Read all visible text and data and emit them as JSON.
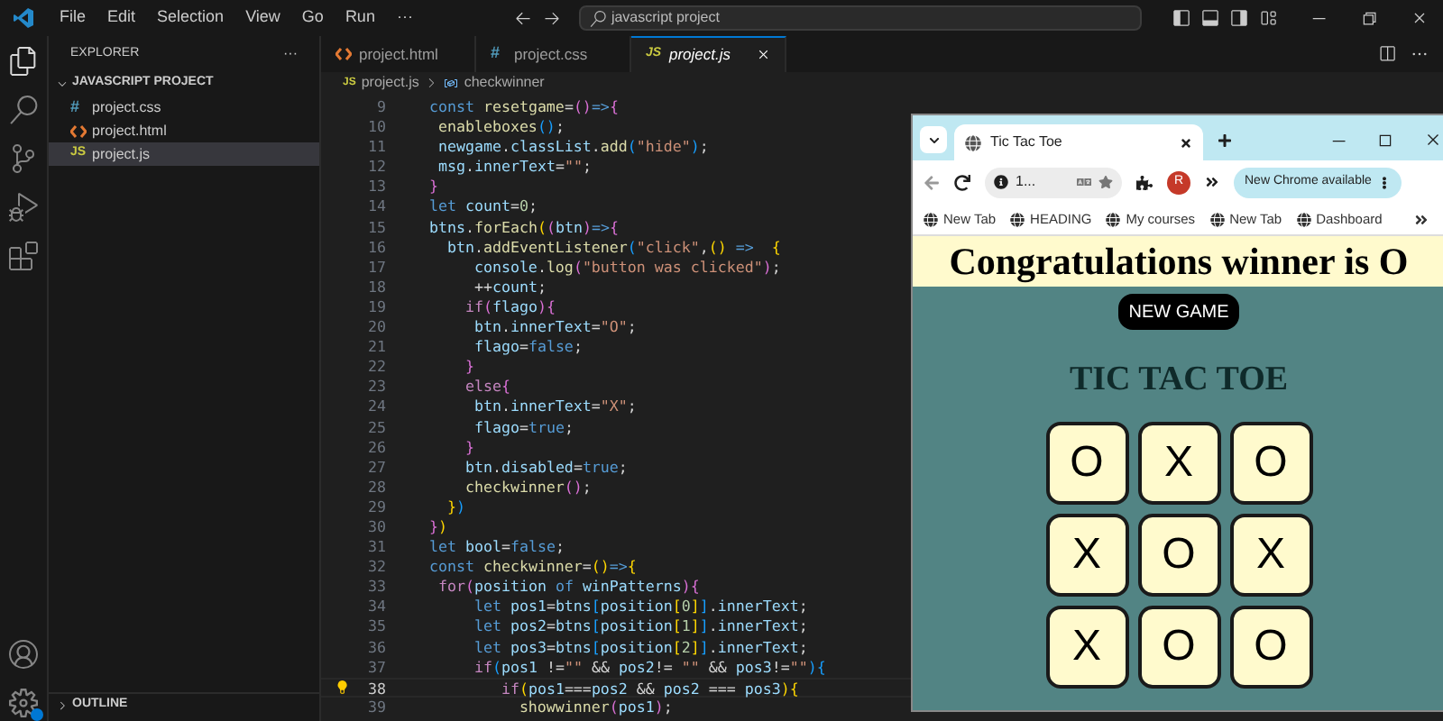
{
  "titlebar": {
    "menu": [
      "File",
      "Edit",
      "Selection",
      "View",
      "Go",
      "Run",
      "···"
    ],
    "search": "javascript project"
  },
  "explorer": {
    "title": "EXPLORER",
    "more": "···",
    "project": {
      "name": "JAVASCRIPT PROJECT",
      "expanded": true,
      "files": [
        {
          "name": "project.css",
          "kind": "css",
          "badge": "#",
          "selected": false
        },
        {
          "name": "project.html",
          "kind": "html",
          "selected": false
        },
        {
          "name": "project.js",
          "kind": "js",
          "badge": "JS",
          "selected": true
        }
      ]
    },
    "outline": {
      "name": "OUTLINE",
      "expanded": false
    }
  },
  "editor": {
    "tabs": [
      {
        "name": "project.html",
        "kind": "html",
        "selected": false
      },
      {
        "name": "project.css",
        "kind": "css",
        "badge": "#",
        "selected": false
      },
      {
        "name": "project.js",
        "kind": "js",
        "badge": "JS",
        "selected": true
      }
    ],
    "breadcrumb": {
      "file": "project.js",
      "badge": "JS",
      "symbol": "checkwinner"
    },
    "lines": [
      {
        "number": "9",
        "current": false,
        "tokens": [
          {
            "kind": "kw",
            "text": "  const "
          },
          {
            "kind": "fn",
            "text": "resetgame"
          },
          {
            "kind": "op",
            "text": "="
          },
          {
            "kind": "b2",
            "text": "()"
          },
          {
            "kind": "kw",
            "text": "=>"
          },
          {
            "kind": "b2",
            "text": "{"
          }
        ]
      },
      {
        "number": "10",
        "current": false,
        "tokens": [
          {
            "kind": "fn",
            "text": "   enableboxes"
          },
          {
            "kind": "b3",
            "text": "()"
          },
          {
            "kind": "op",
            "text": ";"
          }
        ]
      },
      {
        "number": "11",
        "current": false,
        "tokens": [
          {
            "kind": "var",
            "text": "   newgame"
          },
          {
            "kind": "op",
            "text": "."
          },
          {
            "kind": "var",
            "text": "classList"
          },
          {
            "kind": "op",
            "text": "."
          },
          {
            "kind": "fn",
            "text": "add"
          },
          {
            "kind": "b3",
            "text": "("
          },
          {
            "kind": "str",
            "text": "\"hide\""
          },
          {
            "kind": "b3",
            "text": ")"
          },
          {
            "kind": "op",
            "text": ";"
          }
        ]
      },
      {
        "number": "12",
        "current": false,
        "tokens": [
          {
            "kind": "var",
            "text": "   msg"
          },
          {
            "kind": "op",
            "text": "."
          },
          {
            "kind": "var",
            "text": "innerText"
          },
          {
            "kind": "op",
            "text": "="
          },
          {
            "kind": "str",
            "text": "\"\""
          },
          {
            "kind": "op",
            "text": ";"
          }
        ]
      },
      {
        "number": "13",
        "current": false,
        "tokens": [
          {
            "kind": "b2",
            "text": "  }"
          }
        ]
      },
      {
        "number": "14",
        "current": false,
        "tokens": [
          {
            "kind": "kw",
            "text": "  let "
          },
          {
            "kind": "var",
            "text": "count"
          },
          {
            "kind": "op",
            "text": "="
          },
          {
            "kind": "num",
            "text": "0"
          },
          {
            "kind": "op",
            "text": ";"
          }
        ]
      },
      {
        "number": "15",
        "current": false,
        "tokens": [
          {
            "kind": "var",
            "text": "  btns"
          },
          {
            "kind": "op",
            "text": "."
          },
          {
            "kind": "fn",
            "text": "forEach"
          },
          {
            "kind": "b1",
            "text": "("
          },
          {
            "kind": "b2",
            "text": "("
          },
          {
            "kind": "var",
            "text": "btn"
          },
          {
            "kind": "b2",
            "text": ")"
          },
          {
            "kind": "kw",
            "text": "=>"
          },
          {
            "kind": "b2",
            "text": "{"
          }
        ]
      },
      {
        "number": "16",
        "current": false,
        "tokens": [
          {
            "kind": "var",
            "text": "    btn"
          },
          {
            "kind": "op",
            "text": "."
          },
          {
            "kind": "fn",
            "text": "addEventListener"
          },
          {
            "kind": "b3",
            "text": "("
          },
          {
            "kind": "str",
            "text": "\"click\""
          },
          {
            "kind": "op",
            "text": ","
          },
          {
            "kind": "b1",
            "text": "()"
          },
          {
            "kind": "kw",
            "text": " =>  "
          },
          {
            "kind": "b1",
            "text": "{"
          }
        ]
      },
      {
        "number": "17",
        "current": false,
        "tokens": [
          {
            "kind": "var",
            "text": "       console"
          },
          {
            "kind": "op",
            "text": "."
          },
          {
            "kind": "fn",
            "text": "log"
          },
          {
            "kind": "b2",
            "text": "("
          },
          {
            "kind": "str",
            "text": "\"button was clicked\""
          },
          {
            "kind": "b2",
            "text": ")"
          },
          {
            "kind": "op",
            "text": ";"
          }
        ]
      },
      {
        "number": "18",
        "current": false,
        "tokens": [
          {
            "kind": "op",
            "text": "       ++"
          },
          {
            "kind": "var",
            "text": "count"
          },
          {
            "kind": "op",
            "text": ";"
          }
        ]
      },
      {
        "number": "19",
        "current": false,
        "tokens": [
          {
            "kind": "ctl",
            "text": "      if"
          },
          {
            "kind": "b2",
            "text": "("
          },
          {
            "kind": "var",
            "text": "flago"
          },
          {
            "kind": "b2",
            "text": "){"
          }
        ]
      },
      {
        "number": "20",
        "current": false,
        "tokens": [
          {
            "kind": "var",
            "text": "       btn"
          },
          {
            "kind": "op",
            "text": "."
          },
          {
            "kind": "var",
            "text": "innerText"
          },
          {
            "kind": "op",
            "text": "="
          },
          {
            "kind": "str",
            "text": "\"O\""
          },
          {
            "kind": "op",
            "text": ";"
          }
        ]
      },
      {
        "number": "21",
        "current": false,
        "tokens": [
          {
            "kind": "var",
            "text": "       flago"
          },
          {
            "kind": "op",
            "text": "="
          },
          {
            "kind": "kw",
            "text": "false"
          },
          {
            "kind": "op",
            "text": ";"
          }
        ]
      },
      {
        "number": "22",
        "current": false,
        "tokens": [
          {
            "kind": "b2",
            "text": "      }"
          }
        ]
      },
      {
        "number": "23",
        "current": false,
        "tokens": [
          {
            "kind": "ctl",
            "text": "      else"
          },
          {
            "kind": "b2",
            "text": "{"
          }
        ]
      },
      {
        "number": "24",
        "current": false,
        "tokens": [
          {
            "kind": "var",
            "text": "       btn"
          },
          {
            "kind": "op",
            "text": "."
          },
          {
            "kind": "var",
            "text": "innerText"
          },
          {
            "kind": "op",
            "text": "="
          },
          {
            "kind": "str",
            "text": "\"X\""
          },
          {
            "kind": "op",
            "text": ";"
          }
        ]
      },
      {
        "number": "25",
        "current": false,
        "tokens": [
          {
            "kind": "var",
            "text": "       flago"
          },
          {
            "kind": "op",
            "text": "="
          },
          {
            "kind": "kw",
            "text": "true"
          },
          {
            "kind": "op",
            "text": ";"
          }
        ]
      },
      {
        "number": "26",
        "current": false,
        "tokens": [
          {
            "kind": "b2",
            "text": "      }"
          }
        ]
      },
      {
        "number": "27",
        "current": false,
        "tokens": [
          {
            "kind": "var",
            "text": "      btn"
          },
          {
            "kind": "op",
            "text": "."
          },
          {
            "kind": "var",
            "text": "disabled"
          },
          {
            "kind": "op",
            "text": "="
          },
          {
            "kind": "kw",
            "text": "true"
          },
          {
            "kind": "op",
            "text": ";"
          }
        ]
      },
      {
        "number": "28",
        "current": false,
        "tokens": [
          {
            "kind": "fn",
            "text": "      checkwinner"
          },
          {
            "kind": "b2",
            "text": "()"
          },
          {
            "kind": "op",
            "text": ";"
          }
        ]
      },
      {
        "number": "29",
        "current": false,
        "tokens": [
          {
            "kind": "b1",
            "text": "    }"
          },
          {
            "kind": "b3",
            "text": ")"
          }
        ]
      },
      {
        "number": "30",
        "current": false,
        "tokens": [
          {
            "kind": "b2",
            "text": "  }"
          },
          {
            "kind": "b1",
            "text": ")"
          }
        ]
      },
      {
        "number": "31",
        "current": false,
        "tokens": [
          {
            "kind": "kw",
            "text": "  let "
          },
          {
            "kind": "var",
            "text": "bool"
          },
          {
            "kind": "op",
            "text": "="
          },
          {
            "kind": "kw",
            "text": "false"
          },
          {
            "kind": "op",
            "text": ";"
          }
        ]
      },
      {
        "number": "32",
        "current": false,
        "tokens": [
          {
            "kind": "kw",
            "text": "  const "
          },
          {
            "kind": "fn",
            "text": "checkwinner"
          },
          {
            "kind": "op",
            "text": "="
          },
          {
            "kind": "b1",
            "text": "()"
          },
          {
            "kind": "kw",
            "text": "=>"
          },
          {
            "kind": "b1",
            "text": "{"
          }
        ]
      },
      {
        "number": "33",
        "current": false,
        "tokens": [
          {
            "kind": "ctl",
            "text": "   for"
          },
          {
            "kind": "b2",
            "text": "("
          },
          {
            "kind": "var",
            "text": "position"
          },
          {
            "kind": "kw",
            "text": " of "
          },
          {
            "kind": "var",
            "text": "winPatterns"
          },
          {
            "kind": "b2",
            "text": "){"
          }
        ]
      },
      {
        "number": "34",
        "current": false,
        "tokens": [
          {
            "kind": "kw",
            "text": "       let "
          },
          {
            "kind": "var",
            "text": "pos1"
          },
          {
            "kind": "op",
            "text": "="
          },
          {
            "kind": "var",
            "text": "btns"
          },
          {
            "kind": "b3",
            "text": "["
          },
          {
            "kind": "var",
            "text": "position"
          },
          {
            "kind": "b1",
            "text": "["
          },
          {
            "kind": "num",
            "text": "0"
          },
          {
            "kind": "b1",
            "text": "]"
          },
          {
            "kind": "b3",
            "text": "]"
          },
          {
            "kind": "op",
            "text": "."
          },
          {
            "kind": "var",
            "text": "innerText"
          },
          {
            "kind": "op",
            "text": ";"
          }
        ]
      },
      {
        "number": "35",
        "current": false,
        "tokens": [
          {
            "kind": "kw",
            "text": "       let "
          },
          {
            "kind": "var",
            "text": "pos2"
          },
          {
            "kind": "op",
            "text": "="
          },
          {
            "kind": "var",
            "text": "btns"
          },
          {
            "kind": "b3",
            "text": "["
          },
          {
            "kind": "var",
            "text": "position"
          },
          {
            "kind": "b1",
            "text": "["
          },
          {
            "kind": "num",
            "text": "1"
          },
          {
            "kind": "b1",
            "text": "]"
          },
          {
            "kind": "b3",
            "text": "]"
          },
          {
            "kind": "op",
            "text": "."
          },
          {
            "kind": "var",
            "text": "innerText"
          },
          {
            "kind": "op",
            "text": ";"
          }
        ]
      },
      {
        "number": "36",
        "current": false,
        "tokens": [
          {
            "kind": "kw",
            "text": "       let "
          },
          {
            "kind": "var",
            "text": "pos3"
          },
          {
            "kind": "op",
            "text": "="
          },
          {
            "kind": "var",
            "text": "btns"
          },
          {
            "kind": "b3",
            "text": "["
          },
          {
            "kind": "var",
            "text": "position"
          },
          {
            "kind": "b1",
            "text": "["
          },
          {
            "kind": "num",
            "text": "2"
          },
          {
            "kind": "b1",
            "text": "]"
          },
          {
            "kind": "b3",
            "text": "]"
          },
          {
            "kind": "op",
            "text": "."
          },
          {
            "kind": "var",
            "text": "innerText"
          },
          {
            "kind": "op",
            "text": ";"
          }
        ]
      },
      {
        "number": "37",
        "current": false,
        "tokens": [
          {
            "kind": "ctl",
            "text": "       if"
          },
          {
            "kind": "b3",
            "text": "("
          },
          {
            "kind": "var",
            "text": "pos1"
          },
          {
            "kind": "op",
            "text": " !="
          },
          {
            "kind": "str",
            "text": "\"\""
          },
          {
            "kind": "op",
            "text": " && "
          },
          {
            "kind": "var",
            "text": "pos2"
          },
          {
            "kind": "op",
            "text": "!= "
          },
          {
            "kind": "str",
            "text": "\"\""
          },
          {
            "kind": "op",
            "text": " && "
          },
          {
            "kind": "var",
            "text": "pos3"
          },
          {
            "kind": "op",
            "text": "!="
          },
          {
            "kind": "str",
            "text": "\"\""
          },
          {
            "kind": "b3",
            "text": "){"
          }
        ]
      },
      {
        "number": "38",
        "current": true,
        "tokens": [
          {
            "kind": "ctl",
            "text": "          if"
          },
          {
            "kind": "b1",
            "text": "("
          },
          {
            "kind": "var",
            "text": "pos1"
          },
          {
            "kind": "op",
            "text": "==="
          },
          {
            "kind": "var",
            "text": "pos2"
          },
          {
            "kind": "op",
            "text": " && "
          },
          {
            "kind": "var",
            "text": "pos2"
          },
          {
            "kind": "op",
            "text": " === "
          },
          {
            "kind": "var",
            "text": "pos3"
          },
          {
            "kind": "b1",
            "text": "){"
          }
        ]
      },
      {
        "number": "39",
        "current": false,
        "tokens": [
          {
            "kind": "fn",
            "text": "            showwinner"
          },
          {
            "kind": "b2",
            "text": "("
          },
          {
            "kind": "var",
            "text": "pos1"
          },
          {
            "kind": "b2",
            "text": ")"
          },
          {
            "kind": "op",
            "text": ";"
          }
        ]
      }
    ]
  },
  "browser": {
    "tab": "Tic Tac Toe",
    "address": "1...",
    "avatar": "R",
    "update": "New Chrome available",
    "bookmarks": [
      "New Tab",
      "HEADING",
      "My courses",
      "New Tab",
      "Dashboard"
    ],
    "page": {
      "message": "Congratulations winner is O",
      "new_game": "NEW GAME",
      "title": "TIC TAC TOE",
      "board": [
        "O",
        "X",
        "O",
        "X",
        "O",
        "X",
        "X",
        "O",
        "O"
      ]
    }
  }
}
